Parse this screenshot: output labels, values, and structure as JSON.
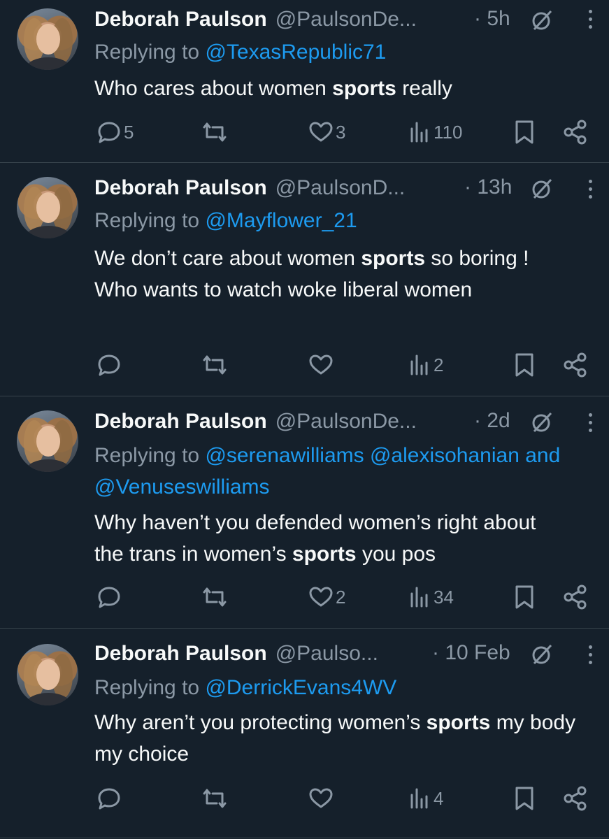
{
  "tweets": [
    {
      "name": "Deborah Paulson",
      "handle": "@PaulsonDe...",
      "time": "· 5h",
      "replying_prefix": "Replying to ",
      "mentions": [
        "@TexasRepublic71"
      ],
      "joiner": "",
      "text_before": "Who cares about women ",
      "text_bold": "sports",
      "text_after": " really",
      "replies": "5",
      "retweets": "",
      "likes": "3",
      "views": "110"
    },
    {
      "name": "Deborah Paulson",
      "handle": "@PaulsonD...",
      "time": "· 13h",
      "replying_prefix": "Replying to ",
      "mentions": [
        "@Mayflower_21"
      ],
      "joiner": "",
      "text_before": "We don’t care about women ",
      "text_bold": "sports",
      "text_after": " so boring ! Who wants to watch woke liberal women",
      "replies": "",
      "retweets": "",
      "likes": "",
      "views": "2"
    },
    {
      "name": "Deborah Paulson",
      "handle": "@PaulsonDe...",
      "time": "· 2d",
      "replying_prefix": "Replying to ",
      "mentions": [
        "@serenawilliams",
        "@alexisohanian",
        "@Venuseswilliams"
      ],
      "joiner": "and",
      "text_before": "Why haven’t you defended women’s right about the trans in women’s ",
      "text_bold": "sports",
      "text_after": " you pos",
      "replies": "",
      "retweets": "",
      "likes": "2",
      "views": "34"
    },
    {
      "name": "Deborah Paulson",
      "handle": "@Paulso...",
      "time": "· 10 Feb",
      "replying_prefix": "Replying to ",
      "mentions": [
        "@DerrickEvans4WV"
      ],
      "joiner": "",
      "text_before": "Why aren’t you protecting women’s ",
      "text_bold": "sports",
      "text_after": " my body my choice",
      "replies": "",
      "retweets": "",
      "likes": "",
      "views": "4"
    }
  ],
  "icons": {
    "reply": "speech-bubble-icon",
    "retweet": "retweet-icon",
    "like": "heart-icon",
    "views": "bar-chart-icon",
    "bookmark": "bookmark-icon",
    "share": "share-icon",
    "grok": "grok-icon",
    "more": "more-vertical-icon"
  },
  "colors": {
    "background": "#15202b",
    "text": "#f7f9f9",
    "muted": "#8b98a5",
    "link": "#1d9bf0",
    "divider": "#38444d"
  }
}
